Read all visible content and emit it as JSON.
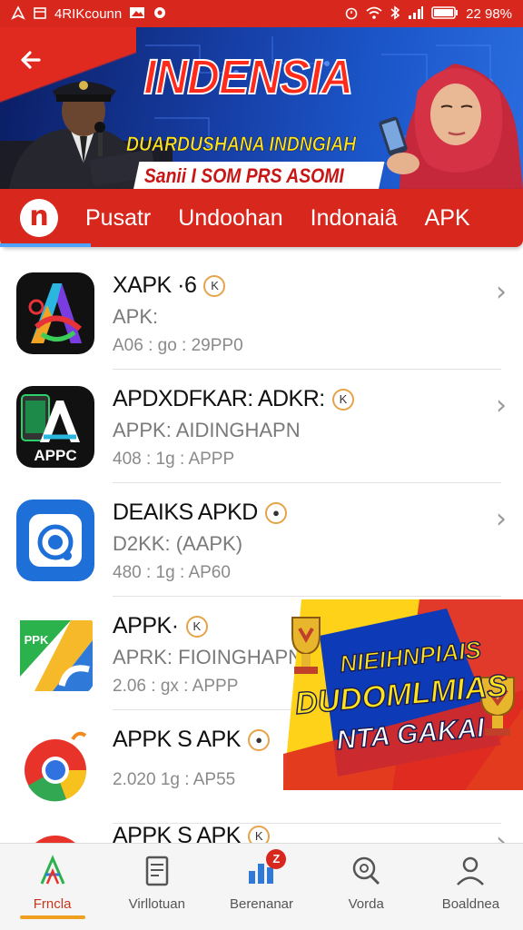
{
  "status_bar": {
    "left_text": "4RIKcounn",
    "right_text": "22 98%",
    "icons": [
      "navigation-icon",
      "calendar-icon",
      "image-icon",
      "target-icon",
      "alarm-icon",
      "wifi-icon",
      "bluetooth-icon",
      "signal-icon",
      "battery-icon"
    ]
  },
  "banner": {
    "title": "INDENSIA",
    "subtitle": "DUARDUSHANA INDNGIAH",
    "strip": "Sanii I SOM PRS ASOMI"
  },
  "tabs": {
    "logo_letter": "n",
    "items": [
      "Pusatr",
      "Undoohan",
      "Indonaiâ",
      "APK"
    ]
  },
  "apps": [
    {
      "name": "XAPK ·6",
      "badge": "K",
      "sub": "APK:",
      "meta": "A06 : go : 29PP0"
    },
    {
      "name": "APDXDFKAR: ADKR:",
      "badge": "K",
      "sub": "APPK: AIDINGHAPN",
      "meta": "408 : 1g : APPP",
      "icon_text": "APPC"
    },
    {
      "name": "DEAIKS APKD",
      "badge": "●",
      "sub": "D2KK: (AAPK)",
      "meta": "480 : 1g : AP60"
    },
    {
      "name": "APPK·",
      "badge": "K",
      "sub": "APRK: FIOINGHAPN",
      "meta": "2.06 : gx : APPP",
      "icon_text": "PPK"
    },
    {
      "name": "APPK S APK",
      "badge": "●",
      "sub": "",
      "meta": "2.020 1g : AP55"
    },
    {
      "name": "APPK S APK",
      "badge": "K",
      "sub": "",
      "meta": ""
    }
  ],
  "promo": {
    "line1": "NIEIHNPIAIS",
    "line2": "DUDOMLMIAS",
    "line3": "NTA GAKAI"
  },
  "bottom_nav": {
    "items": [
      "Frncla",
      "Virllotuan",
      "Berenanar",
      "Vorda",
      "Boaldnea"
    ],
    "notification_badge": "Z"
  },
  "colors": {
    "primary_red": "#d8271d",
    "accent_orange": "#f0a020",
    "banner_blue": "#1740a8"
  }
}
